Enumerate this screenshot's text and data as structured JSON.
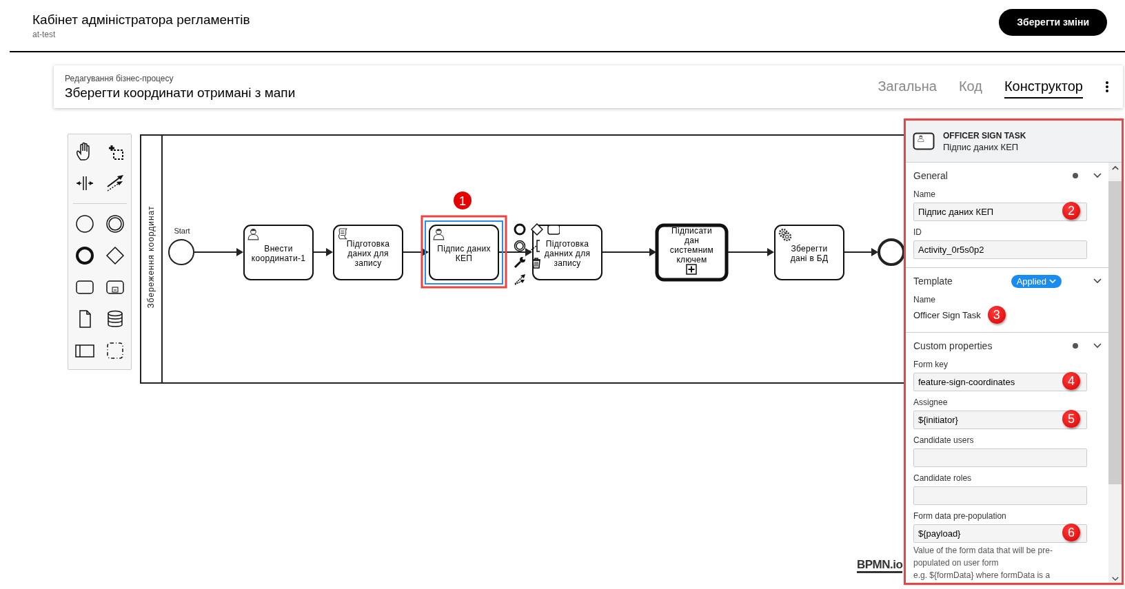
{
  "header": {
    "title": "Кабінет адміністратора регламентів",
    "subtitle": "at-test",
    "save_button": "Зберегти зміни"
  },
  "process": {
    "caption": "Редагування бізнес-процесу",
    "title": "Зберегти координати отримані з мапи",
    "tabs": [
      {
        "label": "Загальна",
        "selected": false
      },
      {
        "label": "Код",
        "selected": false
      },
      {
        "label": "Конструктор",
        "selected": true
      }
    ]
  },
  "diagram": {
    "lane": "Збереження координат",
    "nodes": [
      {
        "kind": "start",
        "label": "Start"
      },
      {
        "kind": "user_task",
        "label": "Внести координати-1",
        "selected": false
      },
      {
        "kind": "script_task",
        "label": "Підготовка даних для запису",
        "selected": false
      },
      {
        "kind": "user_task",
        "label": "Підпис даних КЕП",
        "selected": true,
        "callout": "1"
      },
      {
        "kind": "task",
        "label": "Підготовка данних для запису",
        "selected": false
      },
      {
        "kind": "subprocess",
        "label": "Підписати дан системним ключем",
        "selected": false
      },
      {
        "kind": "service_task",
        "label": "Зберегти дані в БД",
        "selected": false
      },
      {
        "kind": "end"
      }
    ],
    "logo_text": "BPMN.io"
  },
  "properties": {
    "type": "OFFICER SIGN TASK",
    "name": "Підпис даних КЕП",
    "sections": [
      {
        "title": "General",
        "has_values": true,
        "items": [
          {
            "kind": "input",
            "label": "Name",
            "value": "Підпис даних КЕП",
            "callout": "2"
          },
          {
            "kind": "input",
            "label": "ID",
            "value": "Activity_0r5s0p2"
          }
        ]
      },
      {
        "title": "Template",
        "has_values": false,
        "badge": "Applied",
        "items": [
          {
            "kind": "text",
            "label": "Name",
            "value": "Officer Sign Task",
            "callout": "3"
          }
        ]
      },
      {
        "title": "Custom properties",
        "has_values": true,
        "items": [
          {
            "kind": "input",
            "label": "Form key",
            "value": "feature-sign-coordinates",
            "callout": "4"
          },
          {
            "kind": "input",
            "label": "Assignee",
            "value": "${initiator}",
            "callout": "5"
          },
          {
            "kind": "input",
            "label": "Candidate users"
          },
          {
            "kind": "input",
            "label": "Candidate roles"
          },
          {
            "kind": "input",
            "label": "Form data pre-population",
            "value": "${payload}",
            "callout": "6",
            "help": [
              "Value of the form data that will be pre-populated on user form",
              "e.g. ${formData} where formData is a"
            ]
          }
        ]
      }
    ]
  }
}
